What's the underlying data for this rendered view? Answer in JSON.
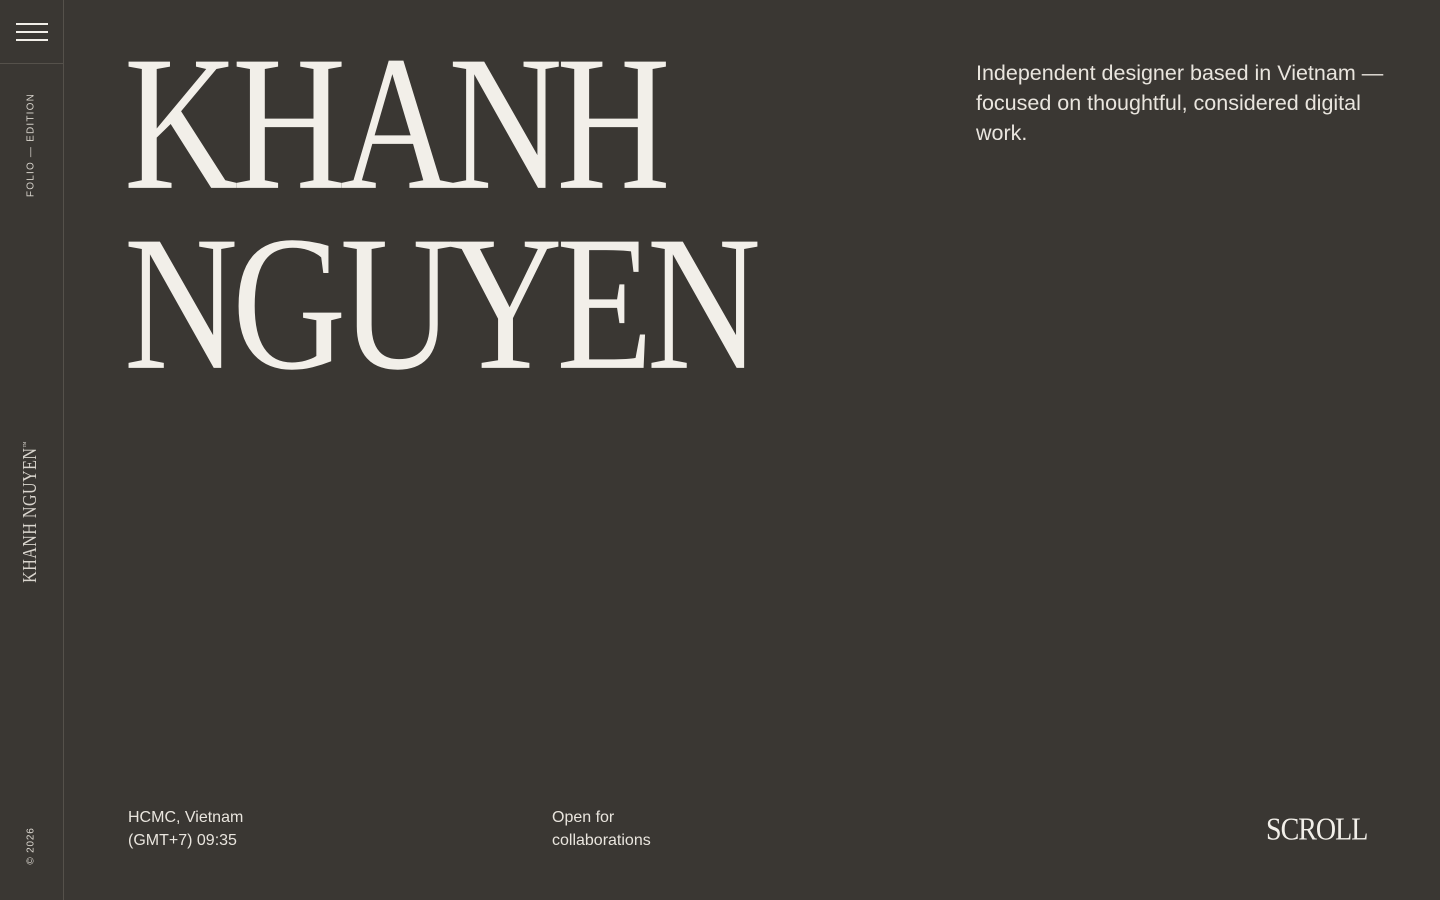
{
  "rail": {
    "edition": "Folio — Edition",
    "name": "KHANH NGUYEN",
    "trademark": "™",
    "copyright": "© 2026"
  },
  "hero": {
    "line1": "KHANH",
    "line2": "NGUYEN"
  },
  "intro": {
    "text": "Independent designer based in Vietnam — focused on thoughtful, considered digital work."
  },
  "footer": {
    "location": "HCMC, Vietnam",
    "time": "(GMT+7) 09:35",
    "availability_line1": "Open for",
    "availability_line2": "collaborations",
    "scroll_label": "SCROLL"
  },
  "colors": {
    "background": "#3a3733",
    "foreground": "#f2efe9",
    "divider": "#55514b"
  }
}
